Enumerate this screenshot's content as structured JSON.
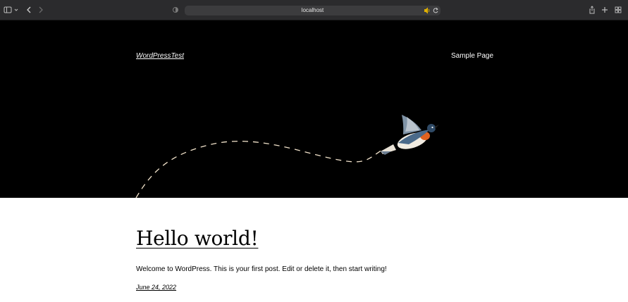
{
  "browser": {
    "address": "localhost",
    "icons": {
      "sidebar": "sidebar-icon",
      "tab_menu": "chevron-down-icon",
      "back": "back-icon",
      "forward": "forward-icon",
      "privacy": "privacy-report-icon",
      "audio": "speaker-icon",
      "reload": "reload-icon",
      "share": "share-icon",
      "new_tab": "plus-icon",
      "tab_overview": "tab-overview-icon"
    }
  },
  "site": {
    "title": "WordPressTest",
    "nav": [
      "Sample Page"
    ]
  },
  "post": {
    "title": "Hello world!",
    "body": "Welcome to WordPress. This is your first post. Edit or delete it, then start writing!",
    "date": "June 24, 2022"
  },
  "colors": {
    "chrome": "#2b2b2d",
    "hero": "#000000",
    "page": "#ffffff",
    "bird_orange": "#e0621f",
    "bird_blue": "#4a6a8a"
  }
}
